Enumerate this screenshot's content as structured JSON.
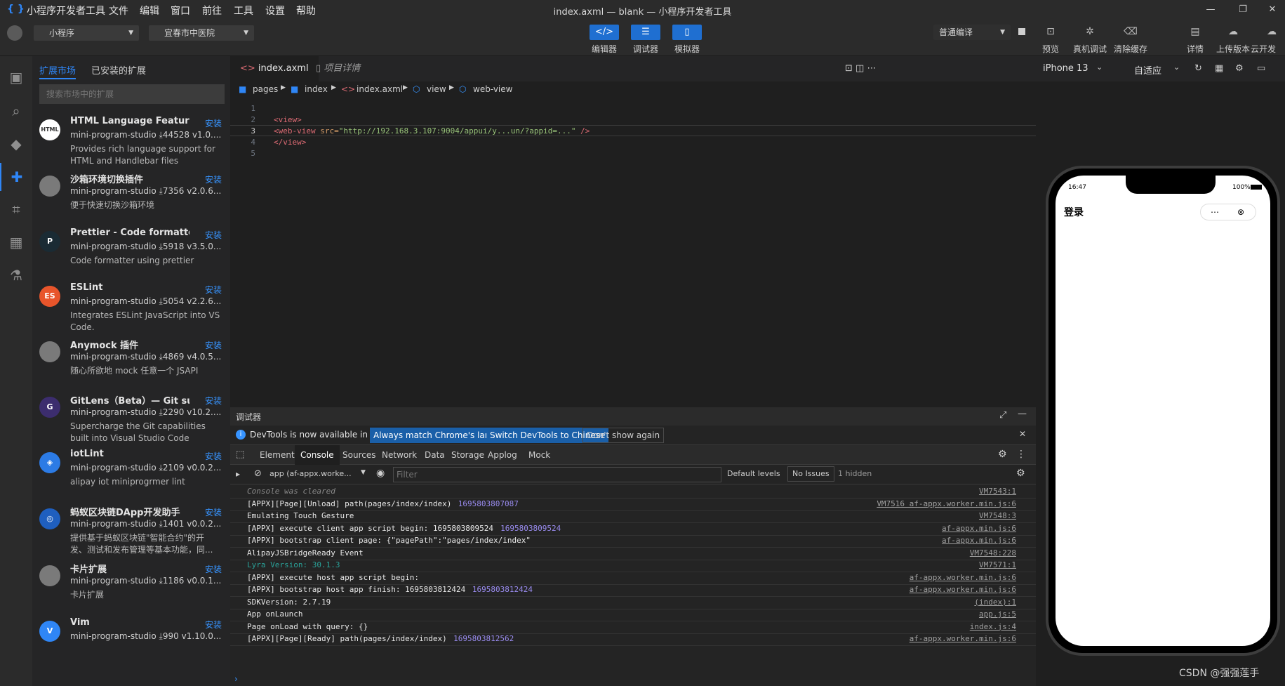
{
  "titlebar": {
    "logo": "{ }",
    "menu": [
      "小程序开发者工具",
      "文件",
      "编辑",
      "窗口",
      "前往",
      "工具",
      "设置",
      "帮助"
    ],
    "title": "index.axml — blank — 小程序开发者工具"
  },
  "toolbar": {
    "project_type": "小程序",
    "hospital": "宜春市中医院",
    "center_buttons": [
      {
        "label": "编辑器",
        "icon": "code-icon"
      },
      {
        "label": "调试器",
        "icon": "sliders-icon"
      },
      {
        "label": "模拟器",
        "icon": "phone-icon"
      }
    ],
    "compile_mode": "普通编译",
    "right_buttons": [
      "预览",
      "真机调试",
      "清除缓存",
      "详情",
      "上传版本",
      "云开发"
    ]
  },
  "extensions": {
    "tabs": [
      "扩展市场",
      "已安装的扩展"
    ],
    "search_placeholder": "搜索市场中的扩展",
    "items": [
      {
        "name": "HTML Language Features",
        "publisher": "mini-program-studio",
        "downloads": "44528",
        "version": "v1.0....",
        "description": "Provides rich language support for HTML and Handlebar files",
        "install": "安装",
        "logo": "HTML",
        "color": "#ffffff"
      },
      {
        "name": "沙箱环境切换插件",
        "publisher": "mini-program-studio",
        "downloads": "7356",
        "version": "v2.0.6...",
        "description": "便于快速切换沙箱环境",
        "install": "安装",
        "logo": "",
        "color": "#7a7a7a"
      },
      {
        "name": "Prettier - Code formatter",
        "publisher": "mini-program-studio",
        "downloads": "5918",
        "version": "v3.5.0...",
        "description": "Code formatter using prettier",
        "install": "安装",
        "logo": "P",
        "color": "#1a2b34"
      },
      {
        "name": "ESLint",
        "publisher": "mini-program-studio",
        "downloads": "5054",
        "version": "v2.2.6...",
        "description": "Integrates ESLint JavaScript into VS Code.",
        "install": "安装",
        "logo": "ES",
        "color": "#e8552b"
      },
      {
        "name": "Anymock 插件",
        "publisher": "mini-program-studio",
        "downloads": "4869",
        "version": "v4.0.5...",
        "description": "随心所欲地 mock 任意一个 JSAPI",
        "install": "安装",
        "logo": "",
        "color": "#7a7a7a"
      },
      {
        "name": "GitLens（Beta）— Git su...",
        "publisher": "mini-program-studio",
        "downloads": "2290",
        "version": "v10.2....",
        "description": "Supercharge the Git capabilities built into Visual Studio Code",
        "install": "安装",
        "logo": "G",
        "color": "#3c2d6e"
      },
      {
        "name": "iotLint",
        "publisher": "mini-program-studio",
        "downloads": "2109",
        "version": "v0.0.2...",
        "description": "alipay iot miniprogrmer lint",
        "install": "安装",
        "logo": "◈",
        "color": "#2c7be5"
      },
      {
        "name": "蚂蚁区块链DApp开发助手",
        "publisher": "mini-program-studio",
        "downloads": "1401",
        "version": "v0.0.2...",
        "description": "提供基于蚂蚁区块链\"智能合约\"的开发、测试和发布管理等基本功能，同...",
        "install": "安装",
        "logo": "◎",
        "color": "#1f5fbf"
      },
      {
        "name": "卡片扩展",
        "publisher": "mini-program-studio",
        "downloads": "1186",
        "version": "v0.0.1...",
        "description": "卡片扩展",
        "install": "安装",
        "logo": "",
        "color": "#7a7a7a"
      },
      {
        "name": "Vim",
        "publisher": "mini-program-studio",
        "downloads": "990",
        "version": "v1.10.0...",
        "description": "",
        "install": "安装",
        "logo": "V",
        "color": "#2f86f6"
      }
    ]
  },
  "editor": {
    "tabs": [
      "index.axml",
      "项目详情"
    ],
    "breadcrumb": [
      "pages",
      "index",
      "index.axml",
      "view",
      "web-view"
    ],
    "lines": [
      "1",
      "2",
      "3",
      "4",
      "5"
    ],
    "code": {
      "l2_open": "<view>",
      "l3_tag": "web-view",
      "l3_attr": "src=",
      "l3_value": "\"http://192.168.3.107:9004/appui/y...un/?appid=...\"",
      "l3_close": "/>",
      "l4": "</view>"
    }
  },
  "device": {
    "model": "iPhone 13",
    "zoom": "自适应",
    "time": "16:47",
    "battery": "100%",
    "page_title": "登录"
  },
  "devtools": {
    "title": "调试器",
    "notice": "DevTools is now available in Chinese!",
    "notice_buttons": [
      "Always match Chrome's language",
      "Switch DevTools to Chinese",
      "Don't show again"
    ],
    "tabs": [
      "Elements",
      "Console",
      "Sources",
      "Network",
      "Data",
      "Storage",
      "Applog",
      "Mock"
    ],
    "context": "app (af-appx.worke...",
    "filter_placeholder": "Filter",
    "levels": "Default levels",
    "issues": "No Issues",
    "hidden": "1 hidden",
    "console": [
      {
        "msg": "Console was cleared",
        "ts": "",
        "src": "VM7543:1"
      },
      {
        "msg": "[APPX][Page][Unload] path(pages/index/index)",
        "ts": "1695803807087",
        "src": "VM7516 af-appx.worker.min.js:6"
      },
      {
        "msg": "Emulating Touch Gesture",
        "ts": "",
        "src": "VM7548:3"
      },
      {
        "msg": "[APPX] execute client app script begin: 1695803809524",
        "ts": "1695803809524",
        "src": "af-appx.min.js:6"
      },
      {
        "msg": "[APPX] bootstrap client page: {\"pagePath\":\"pages/index/index\"",
        "ts": "",
        "src": "af-appx.min.js:6"
      },
      {
        "msg": "AlipayJSBridgeReady Event",
        "ts": "",
        "src": "VM7548:228"
      },
      {
        "msg": "Lyra Version: 30.1.3",
        "ts": "",
        "src": "VM7571:1"
      },
      {
        "msg": "[APPX] execute host app script begin:",
        "ts": "",
        "src": "af-appx.worker.min.js:6"
      },
      {
        "msg": "[APPX] bootstrap host app finish: 1695803812424",
        "ts": "1695803812424",
        "src": "af-appx.worker.min.js:6"
      },
      {
        "msg": "SDKVersion: 2.7.19",
        "ts": "",
        "src": "(index):1"
      },
      {
        "msg": "App onLaunch",
        "ts": "",
        "src": "app.js:5"
      },
      {
        "msg": "Page onLoad with query: {}",
        "ts": "",
        "src": "index.js:4"
      },
      {
        "msg": "[APPX][Page][Ready] path(pages/index/index)",
        "ts": "1695803812562",
        "src": "af-appx.worker.min.js:6"
      }
    ]
  },
  "watermark": "CSDN @强强莲手",
  "colors": {
    "accent": "#2f86f6",
    "primary_button": "#1f6fd1",
    "background": "#1f1f1f"
  }
}
